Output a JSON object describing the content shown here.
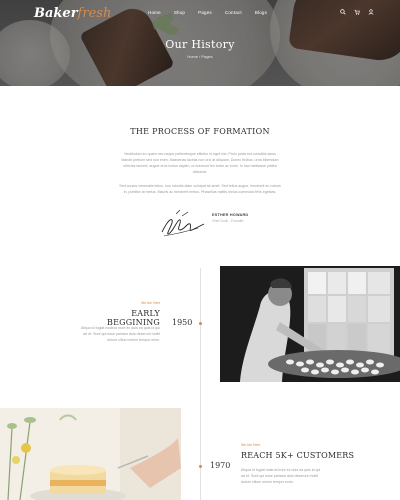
{
  "header": {
    "logo_part1": "Baker",
    "logo_part2": "fresh",
    "nav": [
      "Home",
      "Shop",
      "Pages",
      "Contact",
      "Blogs"
    ],
    "icons": [
      "search-icon",
      "cart-icon",
      "user-icon"
    ]
  },
  "hero": {
    "title": "Our History",
    "breadcrumb": "Home / Pages"
  },
  "process": {
    "title": "THE PROCESS OF FORMATION",
    "paragraph1_lines": [
      "Vestibulum eu quam nec neque pellentesque efficitur id eget nisi. Proin porta est convallis lacus",
      "blandit pretium sed non enim. Maecenas lacinia non orci at aliquam. Donec finibus, urna bibendum",
      "ultricies laoreet, augue eros luctus sapien, ut euismod leo tortor ac enim. In hac habitasse platea",
      "dictumst."
    ],
    "paragraph2_lines": [
      "Sed cursus venenatis tellus, non lobortis diam volutpat sit amet. Sed tellus augue, hendrerit eu rutrum",
      "in, porttitor at metus. Mauris ac hendrerit metus. Phasellus mattis lectus commodo felis egestas."
    ],
    "signer_name": "ESTHER HOWARD",
    "signer_role": "Chef Cook - Founder"
  },
  "timeline": [
    {
      "tag": "We Are Here",
      "title": "EARLY BEGGINING",
      "text_lines": [
        "Aliqua id fugiat nostrud irure ex duis ea quis id qui",
        "ad et. Sunt qui esse pariatur duis deserunt mollit",
        "dolore cillum minim tempor enim."
      ],
      "year": "1950"
    },
    {
      "tag": "We Are Here",
      "title": "REACH 5K+ CUSTOMERS",
      "text_lines": [
        "Aliqua id fugiat nostrud irure ex duis ea quis id qui",
        "ad et. Sunt qui esse pariatur duis deserunt mollit",
        "dolore cillum minim tempor enim."
      ],
      "year": "1970"
    }
  ],
  "colors": {
    "accent": "#d98a4a",
    "heading": "#2a2a2a",
    "body_text": "#9a9a9a"
  }
}
